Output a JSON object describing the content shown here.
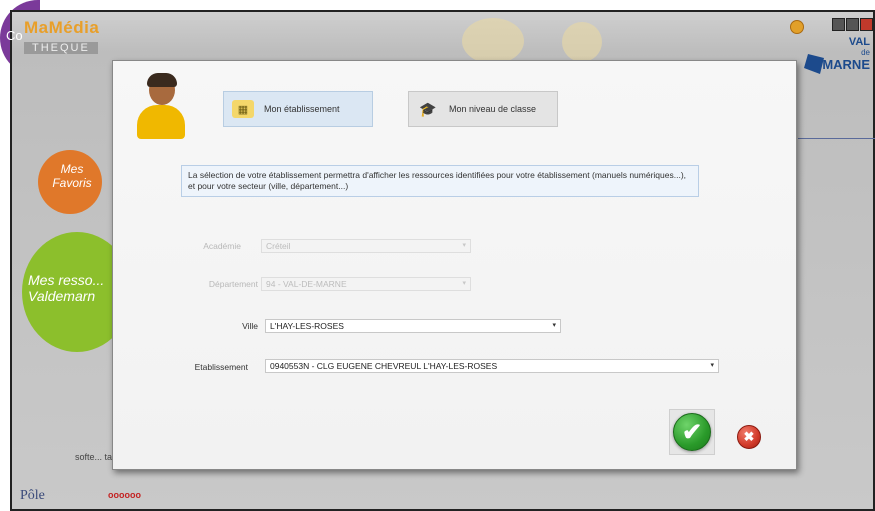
{
  "app": {
    "logo_top": "MaMédia",
    "logo_bottom": "THEQUE",
    "favorites_label": "Mes Favoris",
    "green_label": "Mes resso... Valdemarn",
    "purple_label": "Co",
    "side_text": "softe... tar",
    "pole_label": "Pôle",
    "partner_label": "oooooo",
    "val_de_marne_top": "VAL",
    "val_de_marne_de": "de",
    "val_de_marne_bottom": "MARNE"
  },
  "tabs": {
    "etablissement": "Mon établissement",
    "niveau": "Mon niveau de classe"
  },
  "info_text": "La sélection de votre établissement permettra d'afficher les ressources identifiées pour votre établissement (manuels numériques...), et pour votre secteur (ville, département...)",
  "form": {
    "academie_label": "Académie",
    "academie_value": "Créteil",
    "departement_label": "Département",
    "departement_value": "94 - VAL-DE-MARNE",
    "ville_label": "Ville",
    "ville_value": "L'HAY-LES-ROSES",
    "etablissement_label": "Etablissement",
    "etablissement_value": "0940553N - CLG EUGENE CHEVREUL L'HAY-LES-ROSES"
  },
  "actions": {
    "ok_glyph": "✔",
    "cancel_glyph": "✖"
  },
  "icons": {
    "dropdown_arrow": "▾",
    "school_glyph": "▦",
    "graduation_glyph": "🎓"
  },
  "colors": {
    "tab_active_bg": "#dbe7f3",
    "info_bg": "#eef4fb",
    "ok_green": "#2a9a2a",
    "cancel_red": "#d13a2a"
  }
}
